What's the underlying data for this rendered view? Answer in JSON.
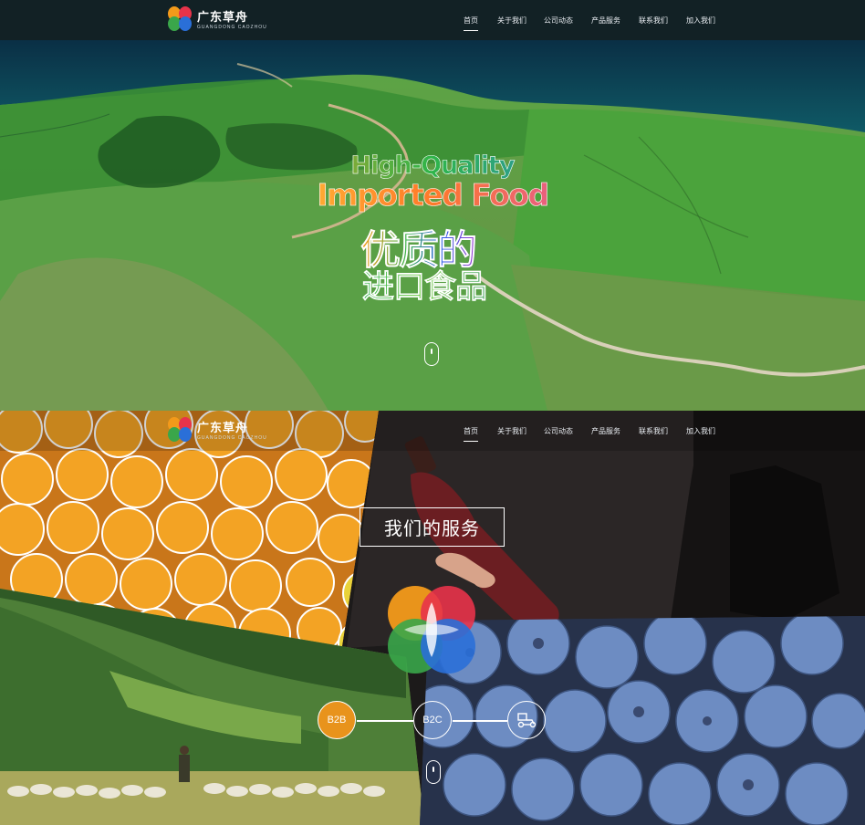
{
  "brand": {
    "name_cn": "广东草舟",
    "name_en": "GUANGDONG CAOZHOU"
  },
  "nav": {
    "items": [
      {
        "label": "首页",
        "active": true
      },
      {
        "label": "关于我们",
        "active": false
      },
      {
        "label": "公司动态",
        "active": false
      },
      {
        "label": "产品服务",
        "active": false
      },
      {
        "label": "联系我们",
        "active": false
      },
      {
        "label": "加入我们",
        "active": false
      }
    ]
  },
  "hero1": {
    "headline_en_1": "High-Quality",
    "headline_en_2": "Imported Food",
    "headline_cn_1": "优质的",
    "headline_cn_2": "进口食品",
    "scroll_icon": "mouse-scroll-icon"
  },
  "hero2": {
    "service_title": "我们的服务",
    "modes": [
      "B2B",
      "B2C"
    ],
    "delivery_icon": "delivery-scooter-icon",
    "scroll_icon": "mouse-scroll-icon"
  },
  "colors": {
    "nav_bg": "#0c1623",
    "b2b_fill": "#e8931c",
    "logo_orange": "#f39a1a",
    "logo_red": "#e8334a",
    "logo_green": "#3aa64a",
    "logo_blue": "#2a6fd8"
  }
}
